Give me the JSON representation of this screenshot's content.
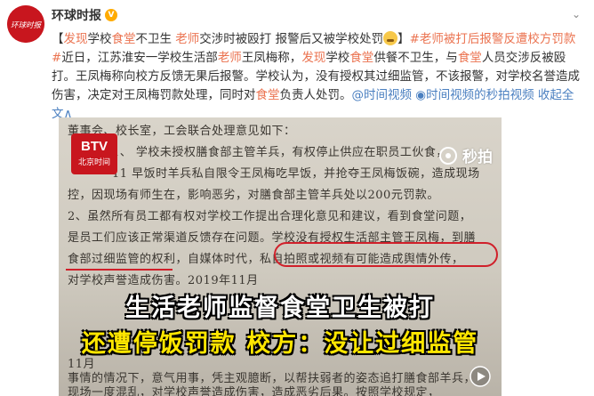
{
  "account": {
    "avatar_text": "环球时报",
    "name": "环球时报",
    "verified_badge": "V"
  },
  "post": {
    "seg1": "【",
    "seg2": "发现",
    "seg3": "学校",
    "seg4": "食堂",
    "seg5": "不卫生 ",
    "seg6": "老师",
    "seg7": "交涉时被殴打 报警后又被学校处罚",
    "seg8": "】",
    "hashtag": "#老师被打后报警反遭校方罚款#",
    "seg9": "近日，江苏淮安一学校生活部",
    "seg10": "老师",
    "seg11": "王凤梅称，",
    "seg12": "发现",
    "seg13": "学校",
    "seg14": "食堂",
    "seg15": "供餐不卫生，与",
    "seg16": "食堂",
    "seg17": "人员交涉反被殴打。王凤梅称向校方反馈无果后报警。学校认为，没有授权其过细监管，不该报警，对学校名誉造成伤害，决定对王凤梅罚款处理，同时对",
    "seg18": "食堂",
    "seg19": "负责人处罚。",
    "video_link": "@时间视频",
    "video_link2": "时间视频的秒拍视频",
    "expand": "收起全文",
    "expand_arrow": "∧"
  },
  "video": {
    "channel_logo_main": "BTV",
    "channel_logo_sub": "北京时间",
    "watermark": "秒拍",
    "doc_lines": [
      "董事会、校长室，工会联合处理意见如下：",
      "1、                学校未授权膳食部主管羊兵，有权停止供应在职员工伙食，",
      "11           早饭时羊兵私自限令王凤梅吃早饭，并抢夺王凤梅饭碗，造成现场",
      "控，因现场有师生在，影响恶劣，对膳食部主管羊兵处以200元罚款。",
      "2、虽然所有员工都有权对学校工作提出合理化意见和建议，看到食堂问题，",
      "是员工们应该正常渠道反馈存在问题。学校没有授权生活部主管王凤梅，到膳",
      "食部过细监管的权利，自媒体时代，私自拍照或视频有可能造成舆情外传，",
      "对学校声誉造成伤害。2019年11月                                                    ",
      "11月                                                          ",
      "事情的情况下，意气用事，凭主观臆断，以帮扶弱者的姿态追打膳食部羊兵，",
      "现场一度混乱，对学校声誉造成伤害，造成恶劣后果。按照学校规定，"
    ],
    "caption_line1": "生活老师监督食堂卫生被打",
    "caption_line2": "还遭停饭罚款 校方：没让过细监管"
  }
}
